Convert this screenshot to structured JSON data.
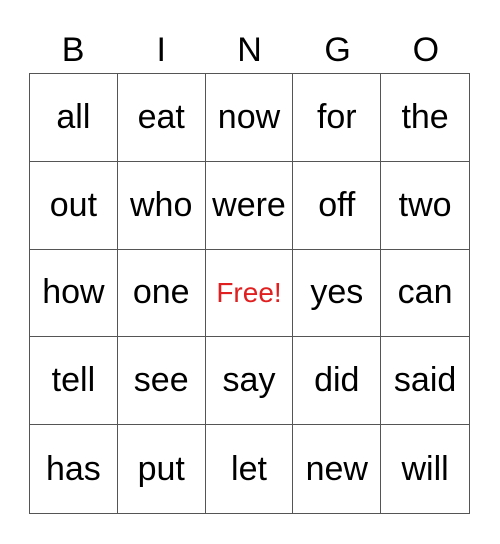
{
  "card": {
    "header": [
      "B",
      "I",
      "N",
      "G",
      "O"
    ],
    "rows": [
      [
        "all",
        "eat",
        "now",
        "for",
        "the"
      ],
      [
        "out",
        "who",
        "were",
        "off",
        "two"
      ],
      [
        "how",
        "one",
        "Free!",
        "yes",
        "can"
      ],
      [
        "tell",
        "see",
        "say",
        "did",
        "said"
      ],
      [
        "has",
        "put",
        "let",
        "new",
        "will"
      ]
    ],
    "free_space": {
      "row": 2,
      "col": 2,
      "color": "#e02020"
    }
  }
}
